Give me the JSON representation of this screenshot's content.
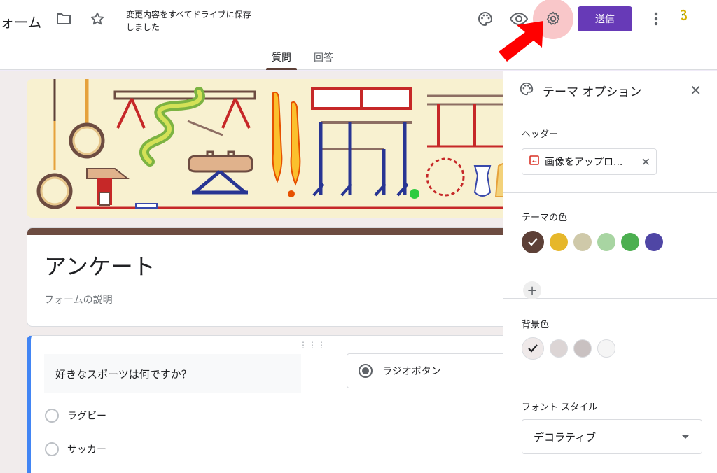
{
  "header": {
    "app_title": "ォーム",
    "save_status": "変更内容をすべてドライブに保存しました",
    "send_label": "送信"
  },
  "tabs": [
    {
      "label": "質問",
      "active": true
    },
    {
      "label": "回答",
      "active": false
    }
  ],
  "form": {
    "title": "アンケート",
    "description_placeholder": "フォームの説明"
  },
  "question": {
    "text": "好きなスポーツは何ですか？",
    "type": "ラジオボタン",
    "options": [
      "ラグビー",
      "サッカー"
    ]
  },
  "theme_panel": {
    "title": "テーマ オプション",
    "header_label": "ヘッダー",
    "upload_label": "画像をアップロ...",
    "theme_color_label": "テーマの色",
    "theme_colors": [
      "#5d4037",
      "#e6b72a",
      "#cfc9a9",
      "#a8d5a2",
      "#4caf50",
      "#4f46a5"
    ],
    "theme_color_selected": 0,
    "bg_color_label": "背景色",
    "bg_colors": [
      "#efe9e9",
      "#dcd5d5",
      "#c9c1c1",
      "#f5f5f5"
    ],
    "bg_color_selected": 0,
    "font_style_label": "フォント スタイル",
    "font_style_value": "デコラティブ"
  },
  "colors": {
    "accent": "#673ab7",
    "theme": "#6d4c41",
    "focus": "#4285f4",
    "annotation": "#ff0000"
  }
}
